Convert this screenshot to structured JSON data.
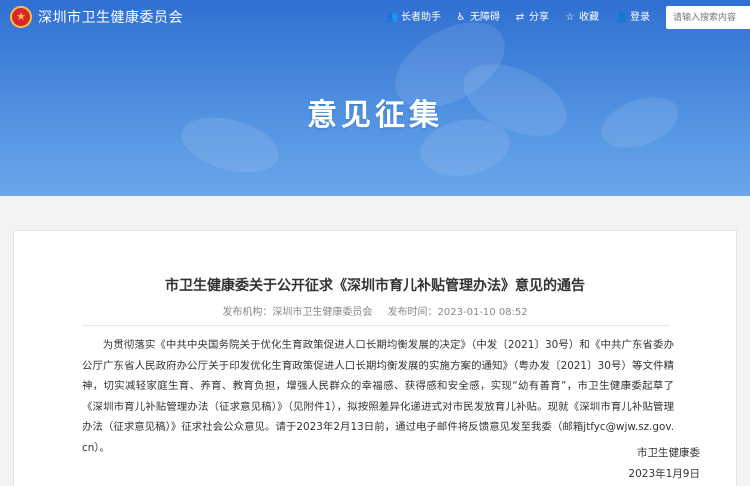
{
  "header": {
    "emblem_glyph": "★",
    "site_name": "深圳市卫生健康委员会",
    "tools": [
      {
        "label": "长者助手",
        "icon": "elder-helper-icon",
        "glyph": "👥"
      },
      {
        "label": "无障碍",
        "icon": "accessibility-icon",
        "glyph": "♿"
      },
      {
        "label": "分享",
        "icon": "share-icon",
        "glyph": "⇄"
      },
      {
        "label": "收藏",
        "icon": "star-icon",
        "glyph": "☆"
      },
      {
        "label": "登录",
        "icon": "user-icon",
        "glyph": "👤"
      }
    ],
    "search_placeholder": "请输入搜索内容"
  },
  "banner": {
    "title": "意见征集"
  },
  "article": {
    "title": "市卫生健康委关于公开征求《深圳市育儿补贴管理办法》意见的通告",
    "publisher_label": "发布机构：",
    "publisher": "深圳市卫生健康委员会",
    "time_label": "发布时间：",
    "time": "2023-01-10 08:52",
    "body": "为贯彻落实《中共中央国务院关于优化生育政策促进人口长期均衡发展的决定》（中发〔2021〕30号）和《中共广东省委办公厅广东省人民政府办公厅关于印发优化生育政策促进人口长期均衡发展的实施方案的通知》（粤办发〔2021〕30号）等文件精神，切实减轻家庭生育、养育、教育负担，增强人民群众的幸福感、获得感和安全感，实现“幼有善育”，市卫生健康委起草了《深圳市育儿补贴管理办法（征求意见稿）》（见附件1），拟按照差异化递进式对市民发放育儿补贴。现就《深圳市育儿补贴管理办法（征求意见稿）》征求社会公众意见。请于2023年2月13日前，通过电子邮件将反馈意见发至我委（邮箱jtfyc@wjw.sz.gov.cn）。",
    "signature": "市卫生健康委",
    "date": "2023年1月9日"
  },
  "colors": {
    "banner": "#3f80da",
    "emblem": "#d8262a"
  }
}
